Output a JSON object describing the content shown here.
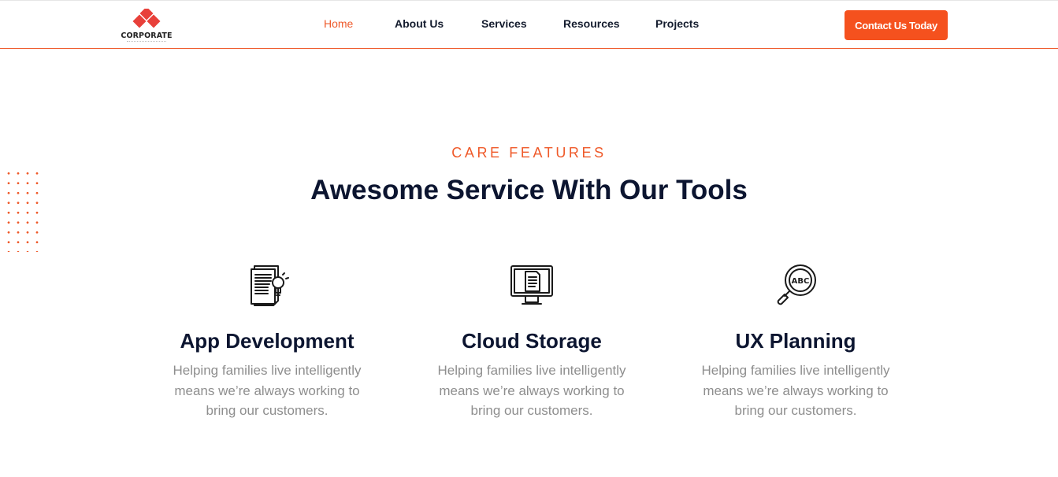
{
  "brand": {
    "logo_text": "CORPORATE",
    "accent": "#ef5a2a",
    "logo_color": "#e8403a"
  },
  "nav": {
    "items": [
      {
        "label": "Home",
        "active": true
      },
      {
        "label": "About Us",
        "active": false
      },
      {
        "label": "Services",
        "active": false
      },
      {
        "label": "Resources",
        "active": false
      },
      {
        "label": "Projects",
        "active": false
      }
    ],
    "cta_label": "Contact Us Today",
    "cta_color": "#f5511e"
  },
  "section": {
    "eyebrow": "CARE FEATURES",
    "title": "Awesome Service With Our Tools"
  },
  "features": [
    {
      "icon": "document-idea-icon",
      "title": "App Development",
      "text": "Helping families live intelligently means we’re always working to bring our customers."
    },
    {
      "icon": "monitor-document-icon",
      "title": "Cloud Storage",
      "text": "Helping families live intelligently means we’re always working to bring our customers."
    },
    {
      "icon": "magnifier-abc-icon",
      "title": "UX Planning",
      "text": "Helping families live intelligently means we’re always working to bring our customers."
    }
  ]
}
